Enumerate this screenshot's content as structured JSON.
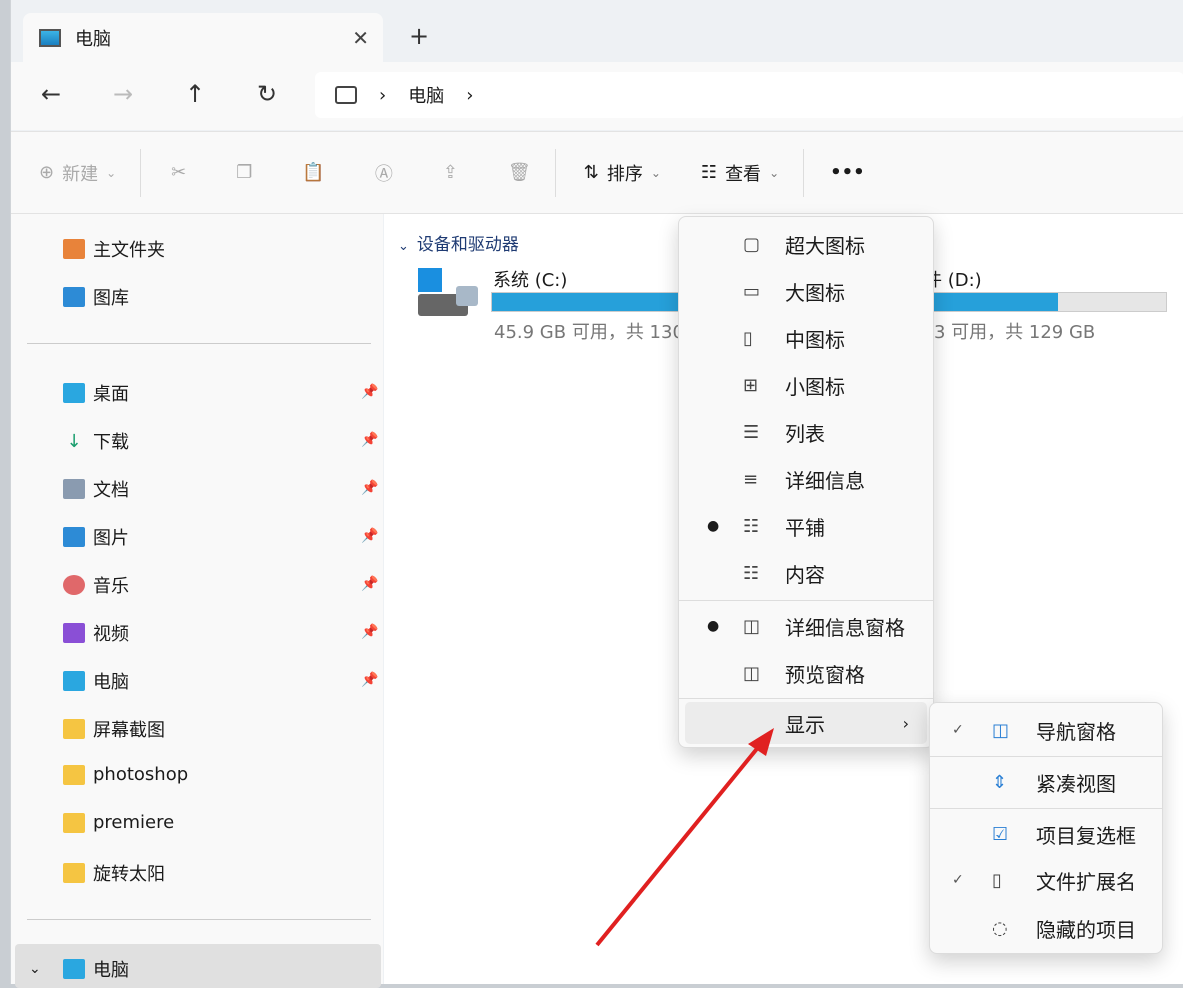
{
  "tab": {
    "title": "电脑",
    "close": "✕",
    "new": "+"
  },
  "nav": {
    "back": "←",
    "forward": "→",
    "up": "↑",
    "refresh": "↻",
    "breadcrumb": [
      "电脑"
    ]
  },
  "toolbar": {
    "new": "新建",
    "sort": "排序",
    "view": "查看",
    "more": "•••"
  },
  "sidebar": {
    "top": [
      "主文件夹",
      "图库"
    ],
    "pinned": [
      "桌面",
      "下载",
      "文档",
      "图片",
      "音乐",
      "视频",
      "电脑"
    ],
    "folders": [
      "屏幕截图",
      "photoshop",
      "premiere",
      "旋转太阳"
    ],
    "bottom": "电脑"
  },
  "main": {
    "section": "设备和驱动器",
    "drives": [
      {
        "name": "系统 (C:)",
        "info": "45.9 GB 可用，共 130",
        "used_pct": 65
      },
      {
        "name": "件 (D:)",
        "info": "3 可用，共 129 GB",
        "used_pct": 70
      }
    ]
  },
  "view_menu": {
    "items": [
      "超大图标",
      "大图标",
      "中图标",
      "小图标",
      "列表",
      "详细信息",
      "平铺",
      "内容"
    ],
    "selected": "平铺",
    "panes": [
      "详细信息窗格",
      "预览窗格"
    ],
    "selected_pane": "详细信息窗格",
    "show": "显示"
  },
  "show_menu": {
    "items": [
      "导航窗格",
      "紧凑视图",
      "项目复选框",
      "文件扩展名",
      "隐藏的项目"
    ],
    "checked": [
      "导航窗格",
      "文件扩展名"
    ]
  },
  "colors": {
    "accent": "#26a0da",
    "arrow": "#e02020"
  }
}
